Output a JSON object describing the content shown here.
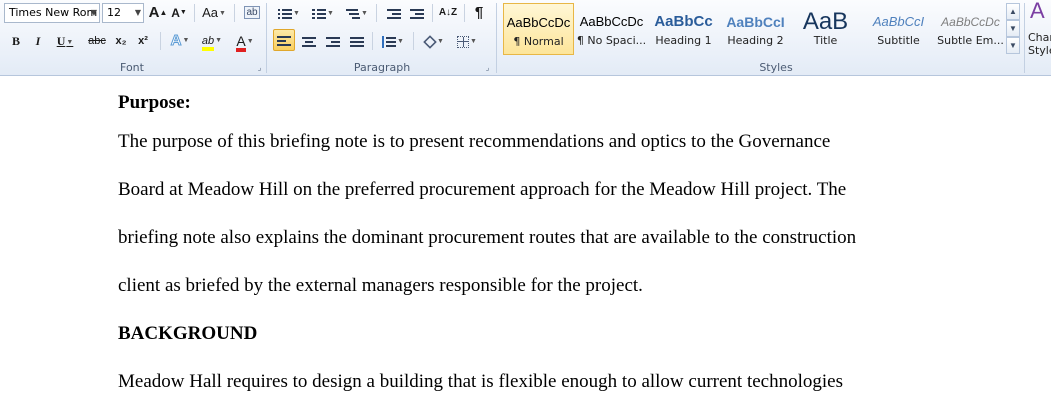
{
  "font_group": {
    "font_name": "Times New Rom",
    "font_size": "12",
    "grow_glyph": "A",
    "shrink_glyph": "A",
    "case_glyph": "Aa",
    "clear_glyph": "ab",
    "bold": "B",
    "italic": "I",
    "underline": "U",
    "strike": "abc",
    "subscript": "x₂",
    "superscript": "x²",
    "effects_glyph": "A",
    "highlight_glyph": "ab",
    "color_glyph": "A",
    "label": "Font",
    "colors": {
      "highlight": "#ffff00",
      "font_color": "#e02020",
      "effects": "#5b9bd5"
    }
  },
  "paragraph_group": {
    "label": "Paragraph",
    "sort_glyph": "A↓Z",
    "pilcrow": "¶"
  },
  "styles_group": {
    "label": "Styles",
    "tiles": [
      {
        "sample": "AaBbCcDc",
        "name": "¶ Normal",
        "selected": true
      },
      {
        "sample": "AaBbCcDc",
        "name": "¶ No Spaci..."
      },
      {
        "sample": "AaBbCc",
        "name": "Heading 1"
      },
      {
        "sample": "AaBbCcI",
        "name": "Heading 2"
      },
      {
        "sample": "AaB",
        "name": "Title"
      },
      {
        "sample": "AaBbCcI",
        "name": "Subtitle"
      },
      {
        "sample": "AaBbCcDc",
        "name": "Subtle Em..."
      }
    ],
    "change_styles_line1": "Chan",
    "change_styles_line2": "Style"
  },
  "document": {
    "heading_purpose": "Purpose:",
    "purpose_lines": [
      "The purpose of this briefing note is to present recommendations and optics to the Governance",
      "Board at Meadow Hill on the preferred procurement approach for the Meadow Hill project. The",
      "briefing note also explains the dominant procurement routes that are available to the construction",
      "client as briefed by the external managers responsible for the project."
    ],
    "heading_background": "BACKGROUND",
    "background_lines": [
      "Meadow Hall requires to design a building that is flexible enough to allow current technologies"
    ]
  }
}
